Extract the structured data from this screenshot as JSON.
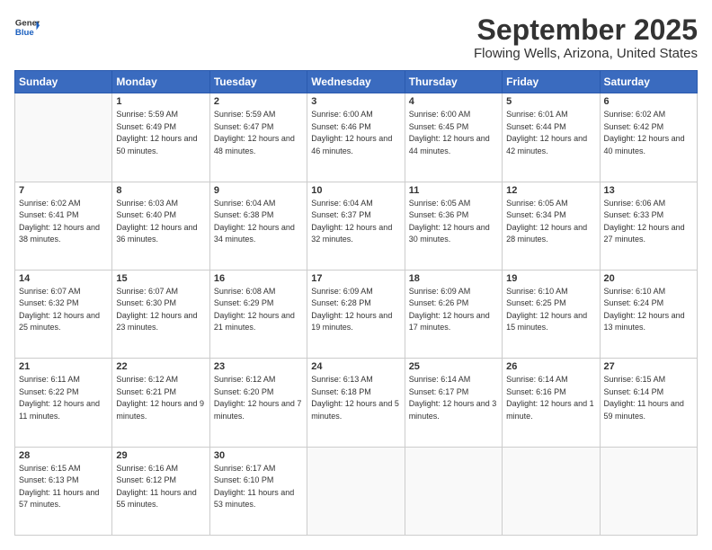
{
  "header": {
    "logo_line1": "General",
    "logo_line2": "Blue",
    "month": "September 2025",
    "location": "Flowing Wells, Arizona, United States"
  },
  "weekdays": [
    "Sunday",
    "Monday",
    "Tuesday",
    "Wednesday",
    "Thursday",
    "Friday",
    "Saturday"
  ],
  "weeks": [
    [
      {
        "day": "",
        "sunrise": "",
        "sunset": "",
        "daylight": ""
      },
      {
        "day": "1",
        "sunrise": "Sunrise: 5:59 AM",
        "sunset": "Sunset: 6:49 PM",
        "daylight": "Daylight: 12 hours and 50 minutes."
      },
      {
        "day": "2",
        "sunrise": "Sunrise: 5:59 AM",
        "sunset": "Sunset: 6:47 PM",
        "daylight": "Daylight: 12 hours and 48 minutes."
      },
      {
        "day": "3",
        "sunrise": "Sunrise: 6:00 AM",
        "sunset": "Sunset: 6:46 PM",
        "daylight": "Daylight: 12 hours and 46 minutes."
      },
      {
        "day": "4",
        "sunrise": "Sunrise: 6:00 AM",
        "sunset": "Sunset: 6:45 PM",
        "daylight": "Daylight: 12 hours and 44 minutes."
      },
      {
        "day": "5",
        "sunrise": "Sunrise: 6:01 AM",
        "sunset": "Sunset: 6:44 PM",
        "daylight": "Daylight: 12 hours and 42 minutes."
      },
      {
        "day": "6",
        "sunrise": "Sunrise: 6:02 AM",
        "sunset": "Sunset: 6:42 PM",
        "daylight": "Daylight: 12 hours and 40 minutes."
      }
    ],
    [
      {
        "day": "7",
        "sunrise": "Sunrise: 6:02 AM",
        "sunset": "Sunset: 6:41 PM",
        "daylight": "Daylight: 12 hours and 38 minutes."
      },
      {
        "day": "8",
        "sunrise": "Sunrise: 6:03 AM",
        "sunset": "Sunset: 6:40 PM",
        "daylight": "Daylight: 12 hours and 36 minutes."
      },
      {
        "day": "9",
        "sunrise": "Sunrise: 6:04 AM",
        "sunset": "Sunset: 6:38 PM",
        "daylight": "Daylight: 12 hours and 34 minutes."
      },
      {
        "day": "10",
        "sunrise": "Sunrise: 6:04 AM",
        "sunset": "Sunset: 6:37 PM",
        "daylight": "Daylight: 12 hours and 32 minutes."
      },
      {
        "day": "11",
        "sunrise": "Sunrise: 6:05 AM",
        "sunset": "Sunset: 6:36 PM",
        "daylight": "Daylight: 12 hours and 30 minutes."
      },
      {
        "day": "12",
        "sunrise": "Sunrise: 6:05 AM",
        "sunset": "Sunset: 6:34 PM",
        "daylight": "Daylight: 12 hours and 28 minutes."
      },
      {
        "day": "13",
        "sunrise": "Sunrise: 6:06 AM",
        "sunset": "Sunset: 6:33 PM",
        "daylight": "Daylight: 12 hours and 27 minutes."
      }
    ],
    [
      {
        "day": "14",
        "sunrise": "Sunrise: 6:07 AM",
        "sunset": "Sunset: 6:32 PM",
        "daylight": "Daylight: 12 hours and 25 minutes."
      },
      {
        "day": "15",
        "sunrise": "Sunrise: 6:07 AM",
        "sunset": "Sunset: 6:30 PM",
        "daylight": "Daylight: 12 hours and 23 minutes."
      },
      {
        "day": "16",
        "sunrise": "Sunrise: 6:08 AM",
        "sunset": "Sunset: 6:29 PM",
        "daylight": "Daylight: 12 hours and 21 minutes."
      },
      {
        "day": "17",
        "sunrise": "Sunrise: 6:09 AM",
        "sunset": "Sunset: 6:28 PM",
        "daylight": "Daylight: 12 hours and 19 minutes."
      },
      {
        "day": "18",
        "sunrise": "Sunrise: 6:09 AM",
        "sunset": "Sunset: 6:26 PM",
        "daylight": "Daylight: 12 hours and 17 minutes."
      },
      {
        "day": "19",
        "sunrise": "Sunrise: 6:10 AM",
        "sunset": "Sunset: 6:25 PM",
        "daylight": "Daylight: 12 hours and 15 minutes."
      },
      {
        "day": "20",
        "sunrise": "Sunrise: 6:10 AM",
        "sunset": "Sunset: 6:24 PM",
        "daylight": "Daylight: 12 hours and 13 minutes."
      }
    ],
    [
      {
        "day": "21",
        "sunrise": "Sunrise: 6:11 AM",
        "sunset": "Sunset: 6:22 PM",
        "daylight": "Daylight: 12 hours and 11 minutes."
      },
      {
        "day": "22",
        "sunrise": "Sunrise: 6:12 AM",
        "sunset": "Sunset: 6:21 PM",
        "daylight": "Daylight: 12 hours and 9 minutes."
      },
      {
        "day": "23",
        "sunrise": "Sunrise: 6:12 AM",
        "sunset": "Sunset: 6:20 PM",
        "daylight": "Daylight: 12 hours and 7 minutes."
      },
      {
        "day": "24",
        "sunrise": "Sunrise: 6:13 AM",
        "sunset": "Sunset: 6:18 PM",
        "daylight": "Daylight: 12 hours and 5 minutes."
      },
      {
        "day": "25",
        "sunrise": "Sunrise: 6:14 AM",
        "sunset": "Sunset: 6:17 PM",
        "daylight": "Daylight: 12 hours and 3 minutes."
      },
      {
        "day": "26",
        "sunrise": "Sunrise: 6:14 AM",
        "sunset": "Sunset: 6:16 PM",
        "daylight": "Daylight: 12 hours and 1 minute."
      },
      {
        "day": "27",
        "sunrise": "Sunrise: 6:15 AM",
        "sunset": "Sunset: 6:14 PM",
        "daylight": "Daylight: 11 hours and 59 minutes."
      }
    ],
    [
      {
        "day": "28",
        "sunrise": "Sunrise: 6:15 AM",
        "sunset": "Sunset: 6:13 PM",
        "daylight": "Daylight: 11 hours and 57 minutes."
      },
      {
        "day": "29",
        "sunrise": "Sunrise: 6:16 AM",
        "sunset": "Sunset: 6:12 PM",
        "daylight": "Daylight: 11 hours and 55 minutes."
      },
      {
        "day": "30",
        "sunrise": "Sunrise: 6:17 AM",
        "sunset": "Sunset: 6:10 PM",
        "daylight": "Daylight: 11 hours and 53 minutes."
      },
      {
        "day": "",
        "sunrise": "",
        "sunset": "",
        "daylight": ""
      },
      {
        "day": "",
        "sunrise": "",
        "sunset": "",
        "daylight": ""
      },
      {
        "day": "",
        "sunrise": "",
        "sunset": "",
        "daylight": ""
      },
      {
        "day": "",
        "sunrise": "",
        "sunset": "",
        "daylight": ""
      }
    ]
  ]
}
